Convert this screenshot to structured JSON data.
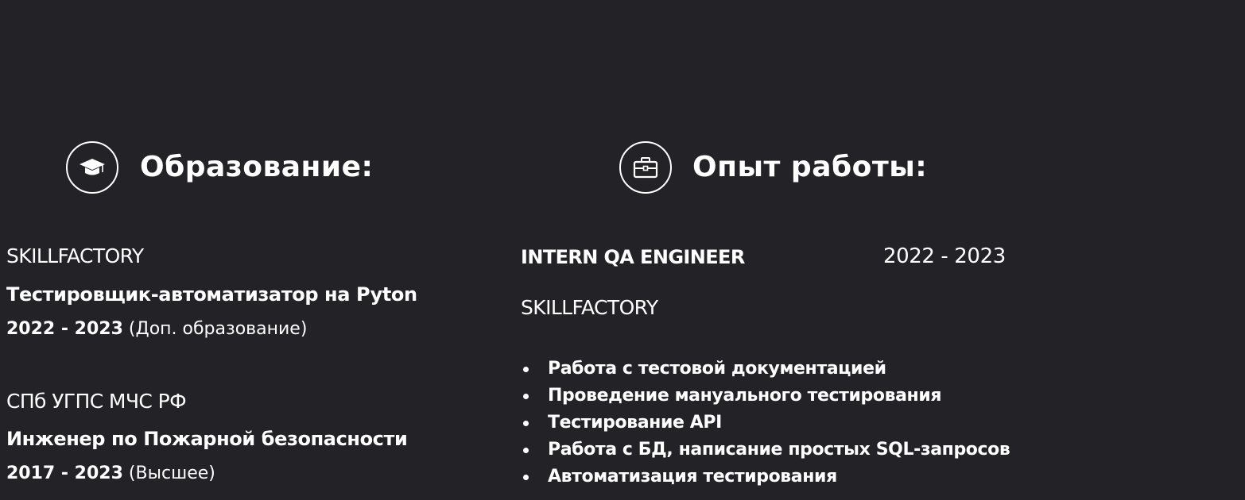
{
  "education": {
    "title": "Образование:",
    "icon": "graduation-cap-icon",
    "entries": [
      {
        "institution": "SKILLFACTORY",
        "specialty": "Тестировщик-автоматизатор на Pyton",
        "years": "2022 - 2023",
        "note": "(Доп. образование)"
      },
      {
        "institution": "СПб УГПС МЧС РФ",
        "specialty": "Инженер по Пожарной безопасности",
        "years": "2017 - 2023",
        "note": "(Высшее)"
      }
    ]
  },
  "experience": {
    "title": "Опыт работы:",
    "icon": "briefcase-icon",
    "job": {
      "position": "INTERN QA ENGINEER",
      "years": "2022 - 2023",
      "company": "SKILLFACTORY",
      "duties": [
        "Работа с тестовой документацией",
        "Проведение мануального тестирования",
        "Тестирование API",
        "Работа с БД, написание простых SQL-запросов",
        "Автоматизация тестирования"
      ]
    }
  }
}
